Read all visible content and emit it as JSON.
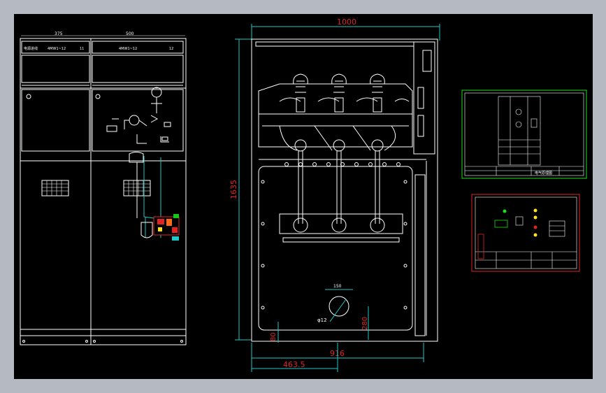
{
  "drawing": {
    "front_view": {
      "width_left": "375",
      "width_right": "500",
      "nameplate_left": "电源进线",
      "nameplate_left_code": "4MW1~12",
      "nameplate_left_num": "11",
      "nameplate_right": "4MW1~12",
      "nameplate_right_num": "12"
    },
    "side_view": {
      "dim_top": "1000",
      "dim_height": "1635",
      "dim_bottom_inner": "916",
      "dim_bottom_half": "463.5",
      "dim_hole_spacing": "150",
      "dim_hole_dia": "φ12",
      "dim_hole_height": "280",
      "dim_base": "80"
    },
    "sheet1": {
      "title": "电气原理图"
    },
    "sheet2": {
      "title": ""
    }
  },
  "colors": {
    "background": "#000000",
    "frame": "#b4b9c2",
    "lines": "#ffffff",
    "dimension": "#e02424",
    "cable": "#1ec8c8",
    "sheet_border_green": "#18e018",
    "sheet_border_red": "#e02424"
  }
}
